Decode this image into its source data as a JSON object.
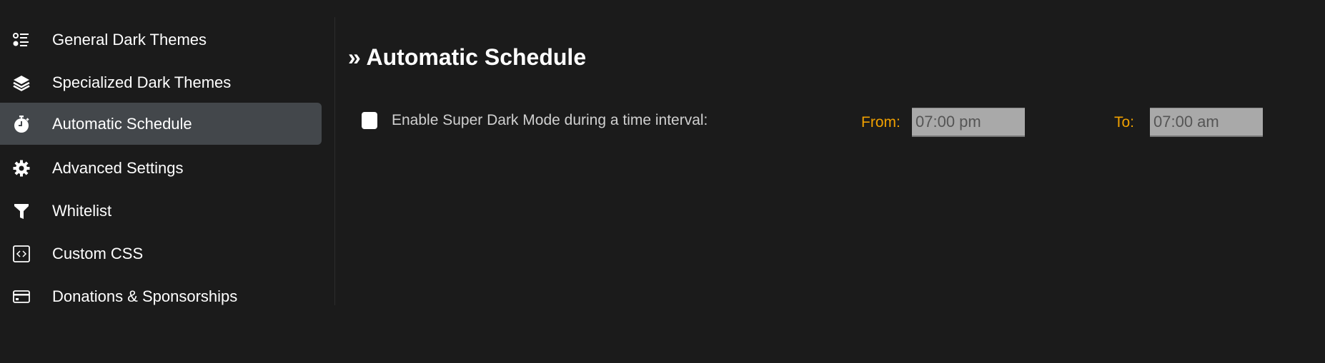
{
  "sidebar": {
    "items": [
      {
        "label": "General Dark Themes",
        "icon": "list-icon"
      },
      {
        "label": "Specialized Dark Themes",
        "icon": "layers-icon"
      },
      {
        "label": "Automatic Schedule",
        "icon": "stopwatch-icon",
        "active": true
      },
      {
        "label": "Advanced Settings",
        "icon": "gear-icon"
      },
      {
        "label": "Whitelist",
        "icon": "filter-icon"
      },
      {
        "label": "Custom CSS",
        "icon": "code-icon"
      },
      {
        "label": "Donations & Sponsorships",
        "icon": "credit-card-icon"
      }
    ]
  },
  "main": {
    "title": "» Automatic Schedule",
    "enable_label": "Enable Super Dark Mode during a time interval:",
    "enabled": false,
    "from_label": "From:",
    "from_value": "07:00 pm",
    "to_label": "To:",
    "to_value": "07:00 am"
  },
  "colors": {
    "accent": "#f0a000",
    "active_bg": "#43474b",
    "background": "#1b1b1b"
  }
}
